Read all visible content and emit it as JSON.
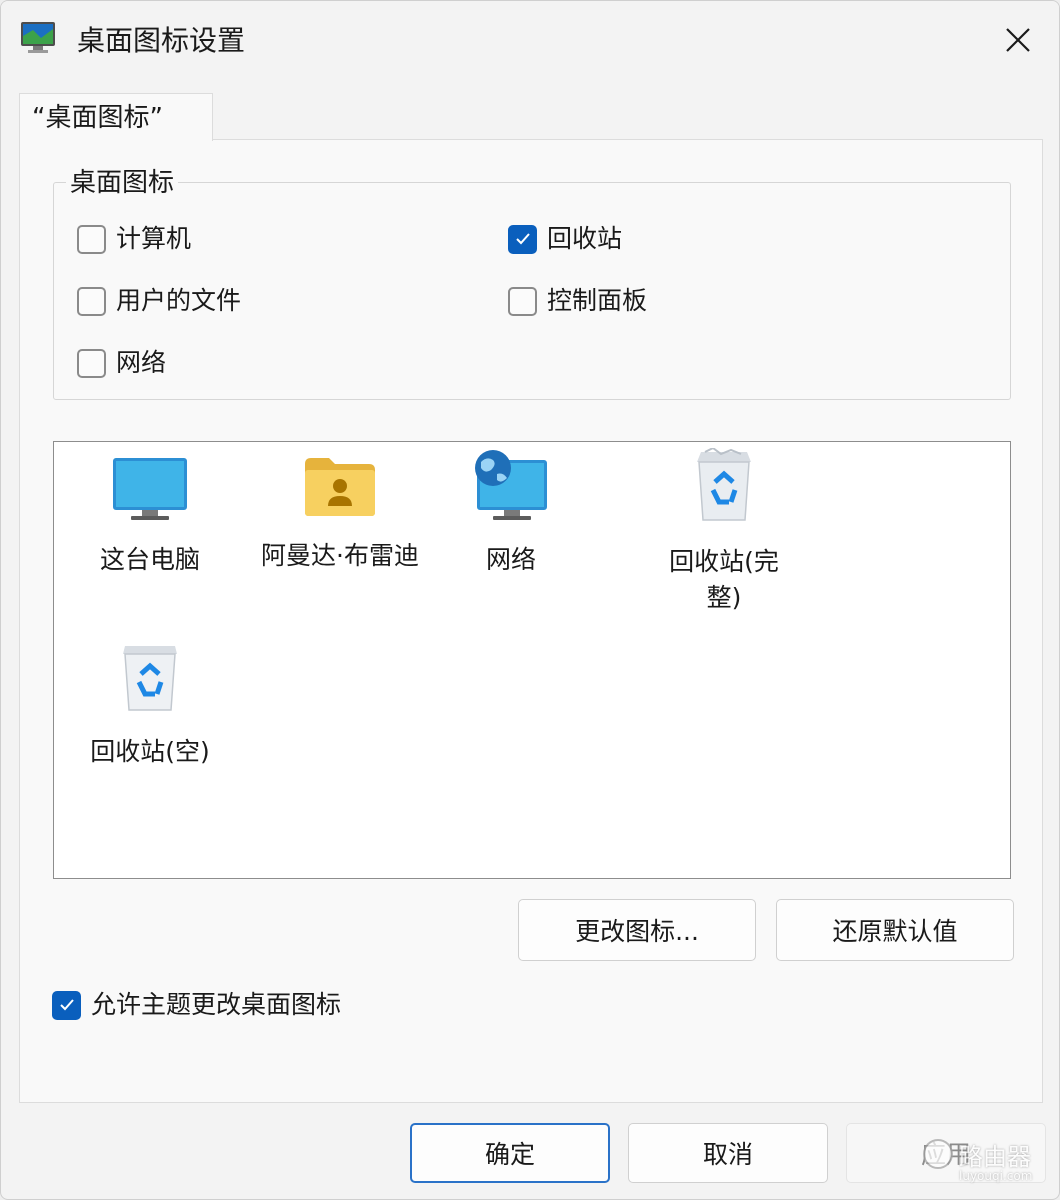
{
  "window": {
    "title": "桌面图标设置",
    "icon": "display-settings-icon",
    "close_icon": "close-icon"
  },
  "tab": {
    "label": "“桌面图标”"
  },
  "group": {
    "legend": "桌面图标",
    "checkboxes": [
      {
        "label": "计算机",
        "checked": false
      },
      {
        "label": "回收站",
        "checked": true
      },
      {
        "label": "用户的文件",
        "checked": false
      },
      {
        "label": "控制面板",
        "checked": false
      },
      {
        "label": "网络",
        "checked": false
      }
    ]
  },
  "preview": {
    "items": [
      {
        "label": "这台电脑",
        "icon": "monitor-icon"
      },
      {
        "label": "阿曼达·布雷迪",
        "icon": "user-folder-icon"
      },
      {
        "label": "网络",
        "icon": "network-globe-icon"
      },
      {
        "label": "回收站(完整)",
        "icon": "recycle-bin-full-icon"
      },
      {
        "label": "回收站(空)",
        "icon": "recycle-bin-empty-icon"
      }
    ],
    "selected": ""
  },
  "buttons": {
    "change_icon": "更改图标...",
    "restore_default": "还原默认值",
    "ok": "确定",
    "cancel": "取消",
    "apply": "应用"
  },
  "theme_option": {
    "label": "允许主题更改桌面图标",
    "checked": true
  },
  "watermark": {
    "text": "路由器",
    "subtext": "luyouqi.com"
  },
  "colors": {
    "accent": "#0a5fbd",
    "panel": "#f9f9f9",
    "window": "#f3f3f3"
  }
}
